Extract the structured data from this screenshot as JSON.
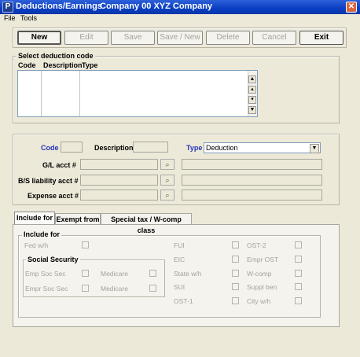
{
  "window": {
    "title": "Deductions/Earnings",
    "company": "Company 00  XYZ Company",
    "app_icon": "P"
  },
  "menu": {
    "file": "File",
    "tools": "Tools"
  },
  "toolbar": {
    "new": "New",
    "edit": "Edit",
    "save": "Save",
    "save_new": "Save / New",
    "delete": "Delete",
    "cancel": "Cancel",
    "exit": "Exit"
  },
  "select_group": {
    "label": "Select deduction code",
    "columns": {
      "code": "Code",
      "description": "Description",
      "type": "Type"
    }
  },
  "form": {
    "code_label": "Code",
    "description_label": "Description",
    "type_label": "Type",
    "type_value": "Deduction",
    "gl_label": "G/L acct #",
    "bs_label": "B/S liability acct #",
    "expense_label": "Expense acct #"
  },
  "tabs": {
    "include_for": "Include for",
    "exempt_from": "Exempt from",
    "special": "Special tax / W-comp class"
  },
  "include": {
    "group_label": "Include for",
    "fed_wh": "Fed w/h",
    "social_security_label": "Social Security",
    "emp_soc_sec": "Emp Soc Sec",
    "empr_soc_sec": "Empr Soc Sec",
    "medicare1": "Medicare",
    "medicare2": "Medicare",
    "fui": "FUI",
    "eic": "EIC",
    "state_wh": "State w/h",
    "sui": "SUI",
    "ost1": "OST-1",
    "ost2": "OST-2",
    "empr_ost": "Empr OST",
    "wcomp": "W-comp",
    "suppl_ben": "Suppl ben",
    "city_wh": "City w/h"
  }
}
